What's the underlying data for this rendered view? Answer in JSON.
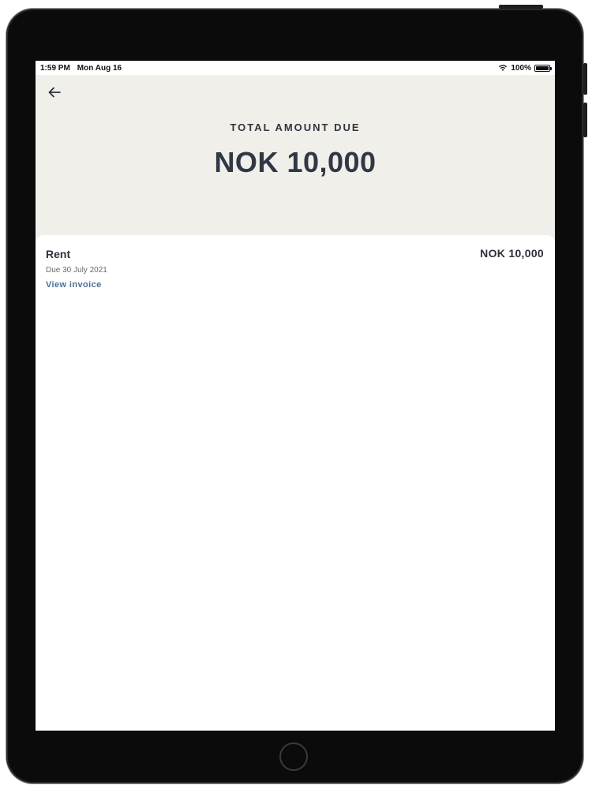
{
  "status_bar": {
    "time": "1:59 PM",
    "date": "Mon Aug 16",
    "battery": "100%",
    "icons": [
      "wifi-icon",
      "battery-icon"
    ]
  },
  "header": {
    "back_icon": "arrow-left-icon",
    "total_label": "TOTAL AMOUNT DUE",
    "total_amount": "NOK 10,000"
  },
  "items": [
    {
      "title": "Rent",
      "amount": "NOK 10,000",
      "due": "Due 30 July 2021",
      "link": "View invoice"
    }
  ],
  "colors": {
    "header_bg": "#f1efea",
    "text_dark": "#303745",
    "link": "#4a6ea8"
  }
}
